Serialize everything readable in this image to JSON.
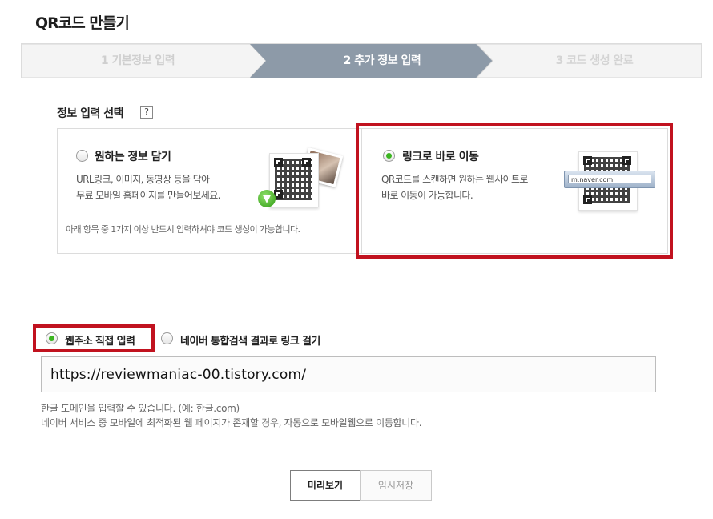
{
  "page": {
    "title": "QR코드 만들기"
  },
  "steps": [
    {
      "label": "1 기본정보 입력",
      "state": "done"
    },
    {
      "label": "2 추가 정보 입력",
      "state": "active"
    },
    {
      "label": "3 코드 생성 완료",
      "state": "pending"
    }
  ],
  "info_select": {
    "label": "정보 입력 선택",
    "help": "?",
    "options": [
      {
        "title": "원하는 정보 담기",
        "desc_line1": "URL링크, 이미지, 동영상 등을 담아",
        "desc_line2": "무료 모바일 홈페이지를 만들어보세요.",
        "note": "아래 항목 중 1가지 이상 반드시 입력하셔야 코드 생성이 가능합니다.",
        "selected": false
      },
      {
        "title": "링크로 바로 이동",
        "desc_line1": "QR코드를 스캔하면 원하는 웹사이트로",
        "desc_line2": "바로 이동이 가능합니다.",
        "url_sample": "m.naver.com",
        "selected": true
      }
    ]
  },
  "link_method": {
    "options": [
      {
        "label": "웹주소 직접 입력",
        "selected": true
      },
      {
        "label": "네이버 통합검색 결과로 링크 걸기",
        "selected": false
      }
    ],
    "url_value": "https://reviewmaniac-00.tistory.com/",
    "hint_line1": "한글 도메인을 입력할 수 있습니다. (예: 한글.com)",
    "hint_line2": "네이버 서비스 중 모바일에 최적화된 웹 페이지가 존재할 경우, 자동으로 모바일웹으로 이동합니다."
  },
  "buttons": {
    "preview": "미리보기",
    "temp_save": "임시저장"
  },
  "colors": {
    "highlight": "#c1121f",
    "radio_on": "#3cb521",
    "step_active": "#8b98a6"
  }
}
